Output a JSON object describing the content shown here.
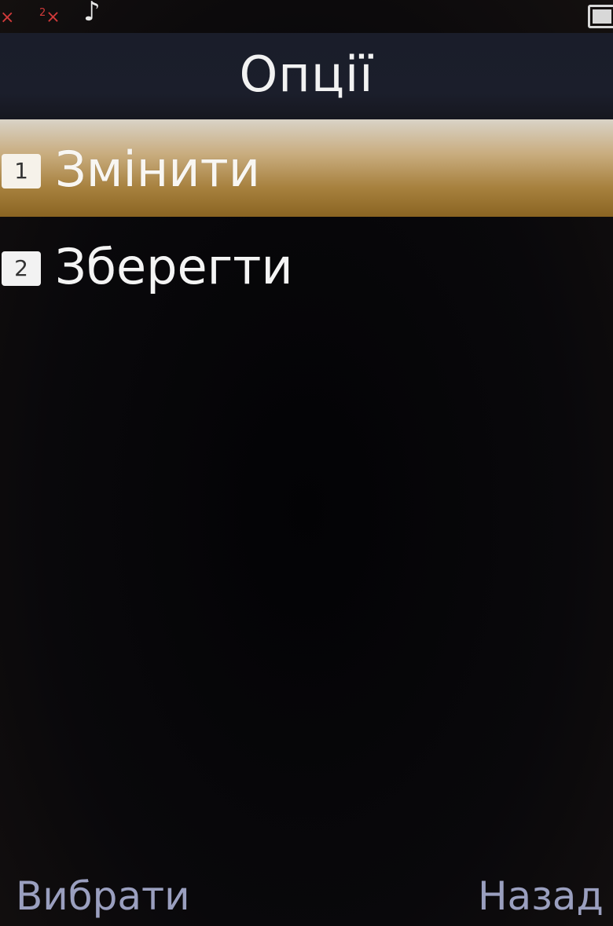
{
  "status_bar": {
    "sim1_icon": "signal-off-icon",
    "sim2_label": "2",
    "sim2_icon": "signal-off-icon",
    "music_icon": "music-note-icon",
    "battery_icon": "battery-full-icon",
    "signal_off_color": "#d23a3a"
  },
  "header": {
    "title": "Опції"
  },
  "menu": {
    "items": [
      {
        "number": "1",
        "label": "Змінити",
        "selected": true
      },
      {
        "number": "2",
        "label": "Зберегти",
        "selected": false
      }
    ],
    "highlight_color": "#b8975a"
  },
  "softkeys": {
    "left": "Вибрати",
    "right": "Назад",
    "color": "#9a9fbf"
  }
}
